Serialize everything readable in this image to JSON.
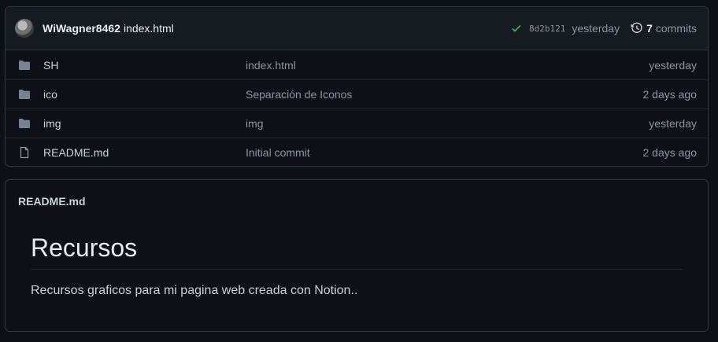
{
  "commit": {
    "author": "WiWagner8462",
    "message": "index.html",
    "sha": "8d2b121",
    "time": "yesterday",
    "commit_count": "7",
    "commits_label": "commits"
  },
  "files": [
    {
      "type": "folder-icon",
      "name": "SH",
      "message": "index.html",
      "date": "yesterday"
    },
    {
      "type": "folder-icon",
      "name": "ico",
      "message": "Separación de Iconos",
      "date": "2 days ago"
    },
    {
      "type": "folder-icon",
      "name": "img",
      "message": "img",
      "date": "yesterday"
    },
    {
      "type": "file-icon",
      "name": "README.md",
      "message": "Initial commit",
      "date": "2 days ago"
    }
  ],
  "readme": {
    "filename": "README.md",
    "heading": "Recursos",
    "paragraph": "Recursos graficos para mi pagina web creada con Notion.."
  },
  "colors": {
    "success": "#3fb950",
    "folder": "#768390"
  }
}
